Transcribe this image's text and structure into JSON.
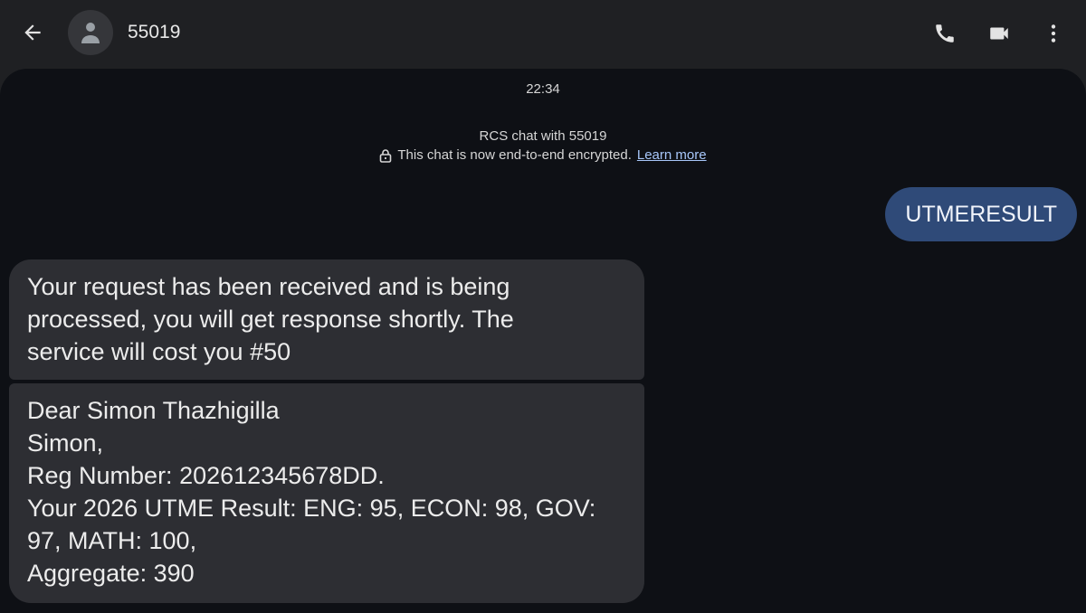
{
  "header": {
    "contact_name": "55019",
    "icons": {
      "back": "arrow-back-icon",
      "avatar": "person-icon",
      "call": "phone-icon",
      "video": "videocam-icon",
      "more": "more-vert-icon"
    }
  },
  "conversation": {
    "timestamp": "22:34",
    "rcs_title": "RCS chat with 55019",
    "encryption_text": "This chat is now end-to-end encrypted.",
    "learn_more": "Learn more",
    "messages": [
      {
        "direction": "sent",
        "lines": [
          "UTMERESULT"
        ]
      },
      {
        "direction": "received",
        "lines": [
          "Your request has been received and is being",
          "processed, you will get response shortly. The",
          "service will cost you #50"
        ]
      },
      {
        "direction": "received",
        "lines": [
          "Dear Simon Thazhigilla",
          "Simon,",
          "Reg Number: 202612345678DD.",
          "Your 2026 UTME Result: ENG: 95, ECON: 98, GOV:",
          "97, MATH: 100,",
          "Aggregate: 390"
        ]
      }
    ]
  },
  "colors": {
    "header_bg": "#1f2023",
    "chat_bg": "#0e1015",
    "sent_bubble": "#2f4a78",
    "received_bubble": "#2d2e33",
    "link": "#a8c7fa"
  }
}
